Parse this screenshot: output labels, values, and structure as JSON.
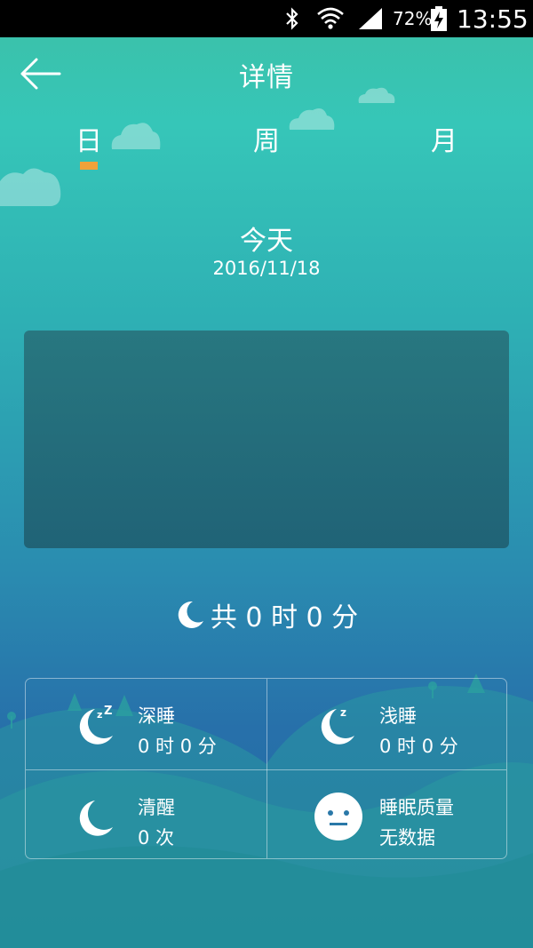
{
  "status_bar": {
    "battery_percent": "72%",
    "time": "13:55"
  },
  "header": {
    "title": "详情"
  },
  "tabs": [
    {
      "label": "日",
      "active": true
    },
    {
      "label": "周",
      "active": false
    },
    {
      "label": "月",
      "active": false
    }
  ],
  "date": {
    "heading": "今天",
    "value": "2016/11/18"
  },
  "total": {
    "text": "共 0 时 0 分"
  },
  "stats": {
    "deep_sleep": {
      "label": "深睡",
      "value": "0 时 0 分",
      "icon": "moon-zzz-icon"
    },
    "light_sleep": {
      "label": "浅睡",
      "value": "0 时 0 分",
      "icon": "moon-z-icon"
    },
    "awake": {
      "label": "清醒",
      "value": "0 次",
      "icon": "moon-icon"
    },
    "quality": {
      "label": "睡眠质量",
      "value": "无数据",
      "icon": "neutral-face-icon"
    }
  },
  "colors": {
    "accent": "#f0a23a",
    "background_top": "#3cc0a6",
    "background_bottom": "#226aa0",
    "chart_bg": "#1f5e70"
  }
}
